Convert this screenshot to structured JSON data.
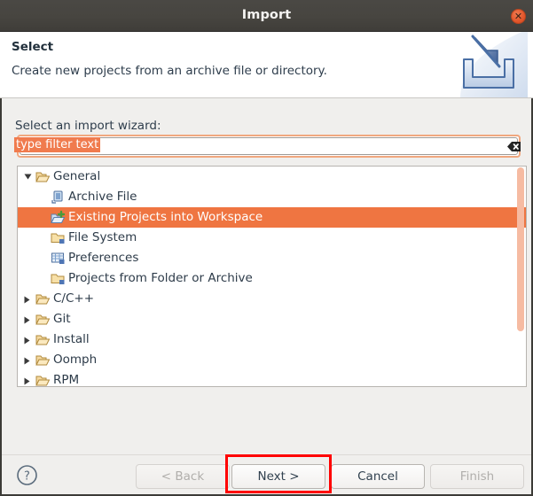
{
  "window": {
    "title": "Import",
    "close_icon": "close-icon"
  },
  "header": {
    "title": "Select",
    "description": "Create new projects from an archive file or directory.",
    "icon": "import-wizard-icon"
  },
  "main": {
    "field_label": "Select an import wizard:",
    "filter": {
      "value": "type filter text",
      "placeholder": "type filter text",
      "clear_icon": "clear-filter-icon",
      "focused": true,
      "selected_text": true
    },
    "tree": {
      "selected": "Existing Projects into Workspace",
      "items": [
        {
          "label": "General",
          "depth": 0,
          "expanded": true,
          "icon": "open-folder-icon",
          "selected": false
        },
        {
          "label": "Archive File",
          "depth": 1,
          "icon": "archive-file-icon",
          "selected": false
        },
        {
          "label": "Existing Projects into Workspace",
          "depth": 1,
          "icon": "import-projects-icon",
          "selected": true
        },
        {
          "label": "File System",
          "depth": 1,
          "icon": "folder-icon",
          "selected": false
        },
        {
          "label": "Preferences",
          "depth": 1,
          "icon": "preferences-icon",
          "selected": false
        },
        {
          "label": "Projects from Folder or Archive",
          "depth": 1,
          "icon": "folder-icon",
          "selected": false
        },
        {
          "label": "C/C++",
          "depth": 0,
          "expanded": false,
          "icon": "open-folder-icon",
          "selected": false
        },
        {
          "label": "Git",
          "depth": 0,
          "expanded": false,
          "icon": "open-folder-icon",
          "selected": false
        },
        {
          "label": "Install",
          "depth": 0,
          "expanded": false,
          "icon": "open-folder-icon",
          "selected": false
        },
        {
          "label": "Oomph",
          "depth": 0,
          "expanded": false,
          "icon": "open-folder-icon",
          "selected": false
        },
        {
          "label": "RPM",
          "depth": 0,
          "expanded": false,
          "icon": "open-folder-icon",
          "selected": false
        }
      ]
    }
  },
  "footer": {
    "help_icon": "help-icon",
    "buttons": [
      {
        "label": "< Back",
        "enabled": false,
        "highlighted": false
      },
      {
        "label": "Next >",
        "enabled": true,
        "highlighted": true
      },
      {
        "label": "Cancel",
        "enabled": true,
        "highlighted": false
      },
      {
        "label": "Finish",
        "enabled": false,
        "highlighted": false
      }
    ]
  },
  "colors": {
    "selection": "#ef7541",
    "focus_border": "#f0a77f",
    "scrollbar": "#f6bba2",
    "titlebar": "#474540",
    "annotation": "#ff0000",
    "body_bg": "#f0efed"
  }
}
